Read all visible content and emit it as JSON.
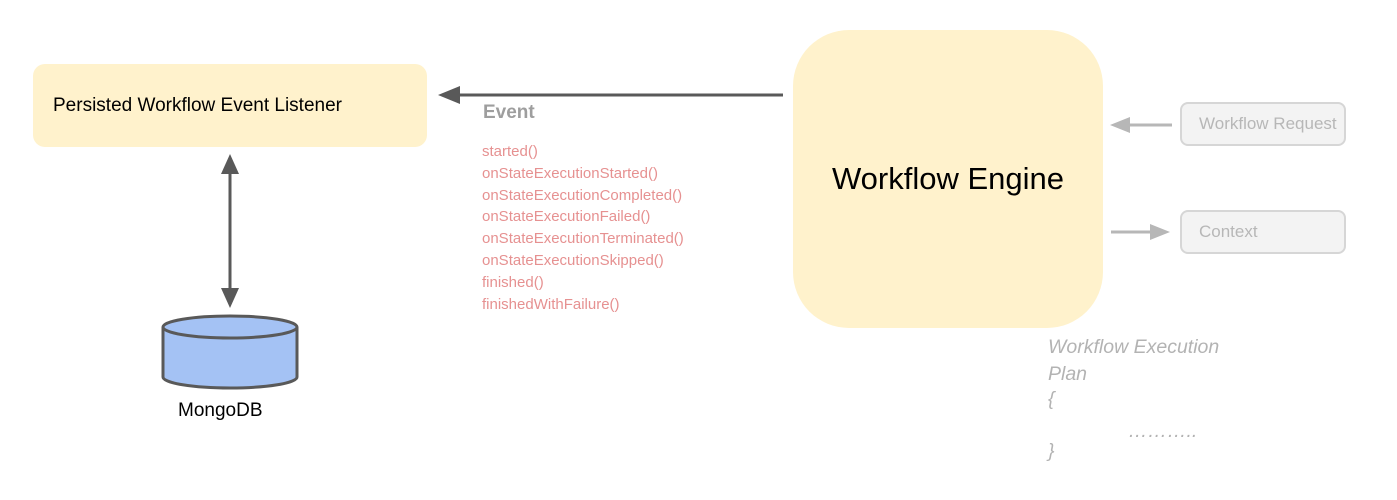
{
  "colors": {
    "box_fill": "#fff2cc",
    "arrow_dark": "#595959",
    "arrow_light": "#b7b7b7",
    "method_text": "#e69191",
    "event_title": "#9e9e9e",
    "faded_text": "#b3b3b3",
    "side_box_text": "#b7b7b7",
    "db_fill": "#a4c2f4",
    "db_stroke": "#595959"
  },
  "listener": {
    "label": "Persisted Workflow Event Listener"
  },
  "engine": {
    "label": "Workflow Engine"
  },
  "inputs": {
    "request_label": "Workflow Request",
    "context_label": "Context"
  },
  "event": {
    "title": "Event",
    "methods": [
      "started()",
      "onStateExecutionStarted()",
      "onStateExecutionCompleted()",
      "onStateExecutionFailed()",
      "onStateExecutionTerminated()",
      "onStateExecutionSkipped()",
      "finished()",
      "finishedWithFailure()"
    ]
  },
  "database": {
    "label": "MongoDB",
    "icon": "database-cylinder-icon"
  },
  "plan": {
    "title_line1": "Workflow Execution",
    "title_line2": "Plan",
    "open_brace": "{",
    "dots": "………..",
    "close_brace": "}"
  }
}
